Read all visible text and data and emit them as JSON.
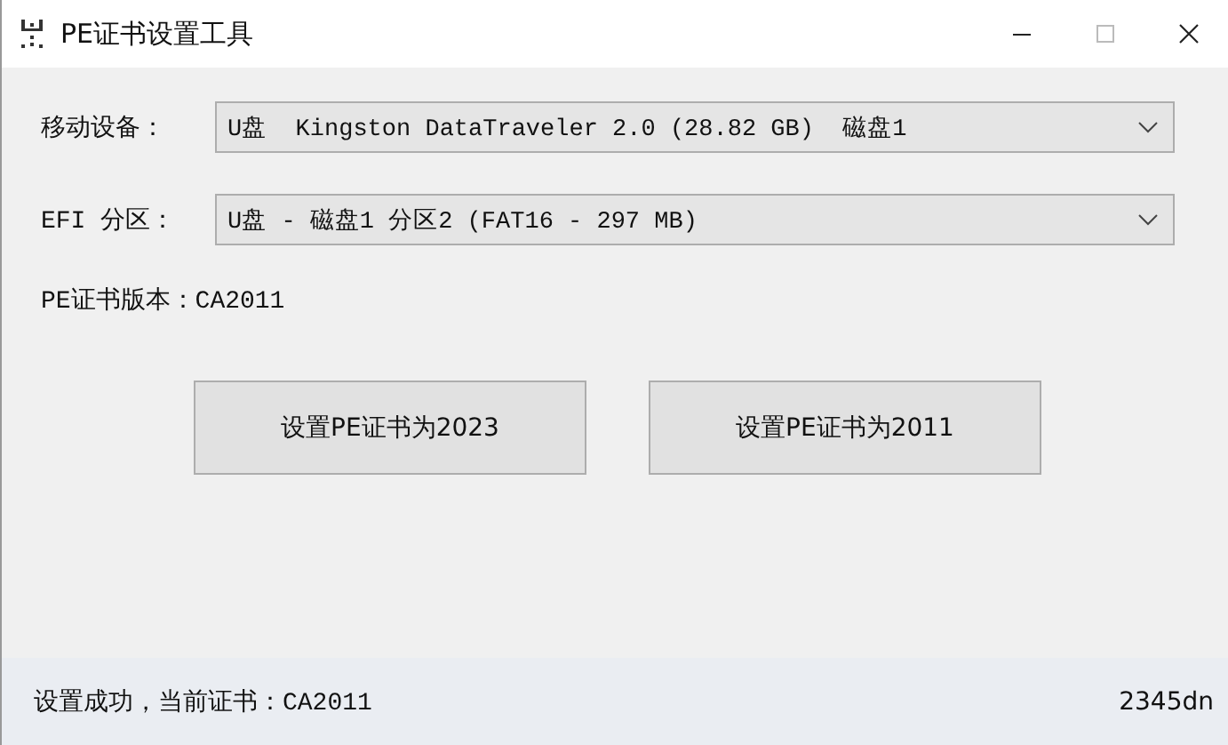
{
  "window": {
    "title": "PE证书设置工具"
  },
  "fields": [
    {
      "label": "移动设备：",
      "value": "U盘  Kingston DataTraveler 2.0 (28.82 GB)  磁盘1"
    },
    {
      "label": "EFI 分区：",
      "value": "U盘 - 磁盘1 分区2 (FAT16 - 297 MB)"
    }
  ],
  "version": "PE证书版本：CA2011",
  "buttons": [
    "设置PE证书为2023",
    "设置PE证书为2011"
  ],
  "status_bar": {
    "message": "设置成功，当前证书：CA2011",
    "brand": "2345dn"
  }
}
